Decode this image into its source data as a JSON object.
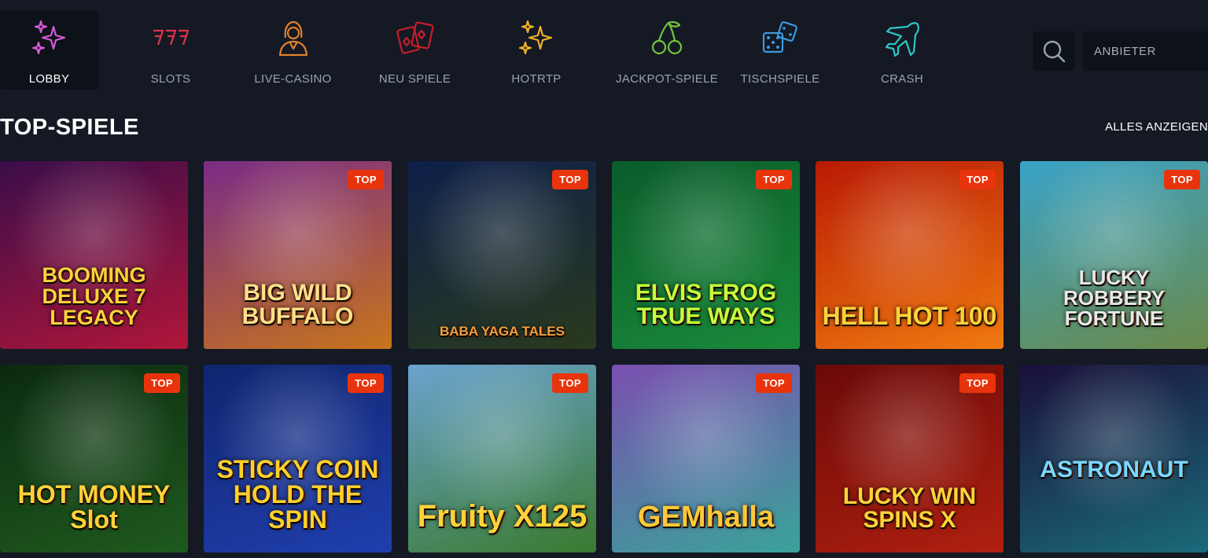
{
  "nav": {
    "items": [
      {
        "label": "LOBBY",
        "icon": "sparkles-icon",
        "active": true
      },
      {
        "label": "SLOTS",
        "icon": "triple-seven-icon"
      },
      {
        "label": "LIVE-CASINO",
        "icon": "dealer-icon"
      },
      {
        "label": "NEU SPIELE",
        "icon": "playing-cards-icon"
      },
      {
        "label": "HOTRTP",
        "icon": "sparkles-icon"
      },
      {
        "label": "JACKPOT-SPIELE",
        "icon": "cherries-icon"
      },
      {
        "label": "TISCHSPIELE",
        "icon": "dice-icon"
      },
      {
        "label": "CRASH",
        "icon": "airplane-icon"
      }
    ],
    "provider_label": "ANBIETER"
  },
  "section": {
    "title": "TOP-SPIELE",
    "show_all": "ALLES ANZEIGEN"
  },
  "badge_label": "TOP",
  "games": [
    {
      "title": "BOOMING DELUXE 7 LEGACY",
      "badge": false,
      "colors": [
        "#3a0d4a",
        "#b0163a"
      ]
    },
    {
      "title": "BIG WILD BUFFALO",
      "badge": true,
      "colors": [
        "#7a2c86",
        "#c7741c"
      ]
    },
    {
      "title": "BABA YAGA TALES",
      "badge": true,
      "colors": [
        "#0e1f4a",
        "#2a3a1d"
      ]
    },
    {
      "title": "ELVIS FROG TRUE WAYS",
      "badge": true,
      "colors": [
        "#0a5c2a",
        "#1a8a3a"
      ]
    },
    {
      "title": "HELL HOT 100",
      "badge": true,
      "colors": [
        "#b81a04",
        "#f07a10"
      ]
    },
    {
      "title": "LUCKY ROBBERY FORTUNE",
      "badge": true,
      "colors": [
        "#3aa3c8",
        "#6a8a4a"
      ]
    },
    {
      "title": "HOT MONEY Slot",
      "badge": true,
      "colors": [
        "#0b2a10",
        "#1f5a1e"
      ]
    },
    {
      "title": "STICKY COIN HOLD THE SPIN",
      "badge": true,
      "colors": [
        "#10256e",
        "#1f3fae"
      ]
    },
    {
      "title": "Fruity X125",
      "badge": true,
      "colors": [
        "#6aa3cf",
        "#3a7a2e"
      ]
    },
    {
      "title": "GEMhalla",
      "badge": true,
      "colors": [
        "#7a4fb0",
        "#3aa39a"
      ]
    },
    {
      "title": "LUCKY WIN SPINS X",
      "badge": true,
      "colors": [
        "#6a0a08",
        "#b02010"
      ]
    },
    {
      "title": "ASTRONAUT",
      "badge": false,
      "colors": [
        "#1a0f3a",
        "#1a6a7a"
      ]
    }
  ]
}
